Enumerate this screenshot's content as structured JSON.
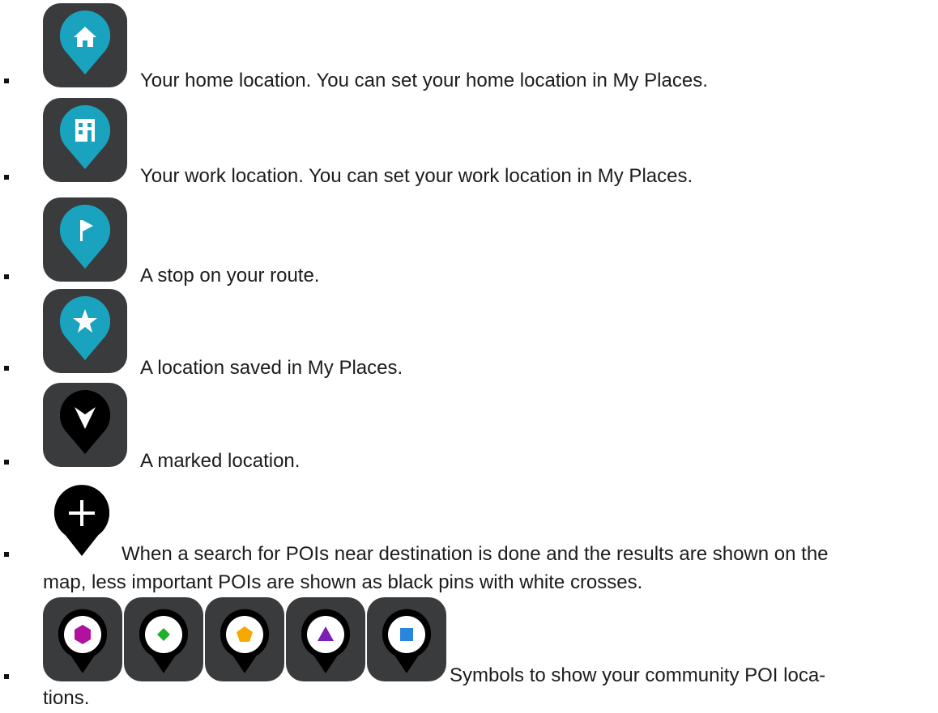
{
  "items": [
    {
      "icon": "home-pin-icon",
      "text": "Your home location. You can set your home location in My Places."
    },
    {
      "icon": "work-pin-icon",
      "text": "Your work location. You can set your work location in My Places."
    },
    {
      "icon": "flag-pin-icon",
      "text": "A stop on your route."
    },
    {
      "icon": "star-pin-icon",
      "text": "A location saved in My Places."
    },
    {
      "icon": "marked-location-pin-icon",
      "text": "A marked location."
    },
    {
      "icon": "poi-cross-pin-icon",
      "text_line1": "When a search for POIs near destination is done and the results are shown on the",
      "text_line2": "map, less important POIs are shown as black pins with white crosses."
    },
    {
      "icons": [
        "community-hexagon-icon",
        "community-diamond-icon",
        "community-pentagon-icon",
        "community-triangle-icon",
        "community-square-icon"
      ],
      "text_line1": "Symbols to show your community POI loca-",
      "text_line2": "tions."
    }
  ],
  "colors": {
    "tile": "#3a3b3d",
    "pin_teal": "#1aa3bf",
    "pin_black": "#000000",
    "hexagon": "#b0129f",
    "diamond": "#1fb12a",
    "pentagon": "#f6a800",
    "triangle": "#7b1fb5",
    "square": "#2a86dc"
  }
}
